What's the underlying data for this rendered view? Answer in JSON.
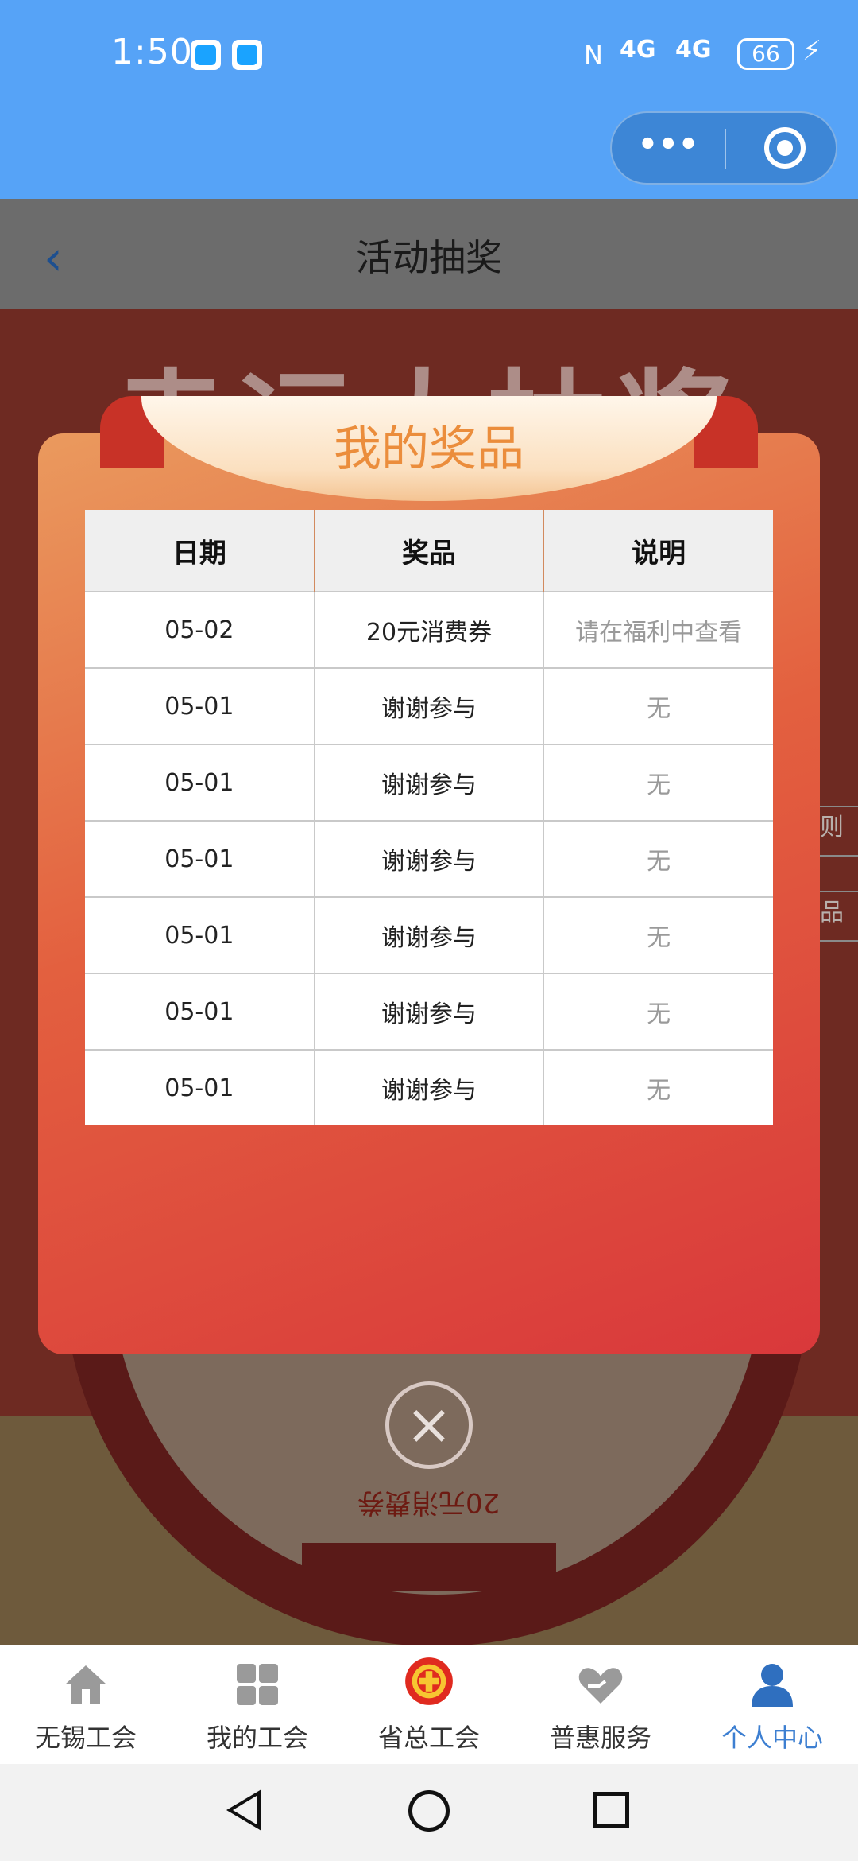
{
  "status_bar": {
    "time": "1:50",
    "nfc": "N",
    "signal1": "4G",
    "signal2": "4G",
    "battery": "66"
  },
  "header": {
    "title": "活动抽奖",
    "capsule_more": "•••"
  },
  "background": {
    "title": "幸运大抽奖",
    "wheel_prize": "20元消费券",
    "side_tab1": "则",
    "side_tab2": "品"
  },
  "modal": {
    "title": "我的奖品",
    "columns": [
      "日期",
      "奖品",
      "说明"
    ],
    "rows": [
      [
        "05-02",
        "20元消费券",
        "请在福利中查看"
      ],
      [
        "05-01",
        "谢谢参与",
        "无"
      ],
      [
        "05-01",
        "谢谢参与",
        "无"
      ],
      [
        "05-01",
        "谢谢参与",
        "无"
      ],
      [
        "05-01",
        "谢谢参与",
        "无"
      ],
      [
        "05-01",
        "谢谢参与",
        "无"
      ],
      [
        "05-01",
        "谢谢参与",
        "无"
      ]
    ],
    "close_symbol": "×"
  },
  "tabbar": {
    "items": [
      {
        "label": "无锡工会",
        "icon": "home-icon"
      },
      {
        "label": "我的工会",
        "icon": "grid-icon"
      },
      {
        "label": "省总工会",
        "icon": "union-emblem-icon"
      },
      {
        "label": "普惠服务",
        "icon": "heart-hand-icon"
      },
      {
        "label": "个人中心",
        "icon": "person-icon"
      }
    ],
    "active_color": "#3d7fd1"
  },
  "colors": {
    "status_bg": "#56a3f7",
    "modal_accent": "#eb8d3c",
    "modal_red": "#d9383b"
  }
}
